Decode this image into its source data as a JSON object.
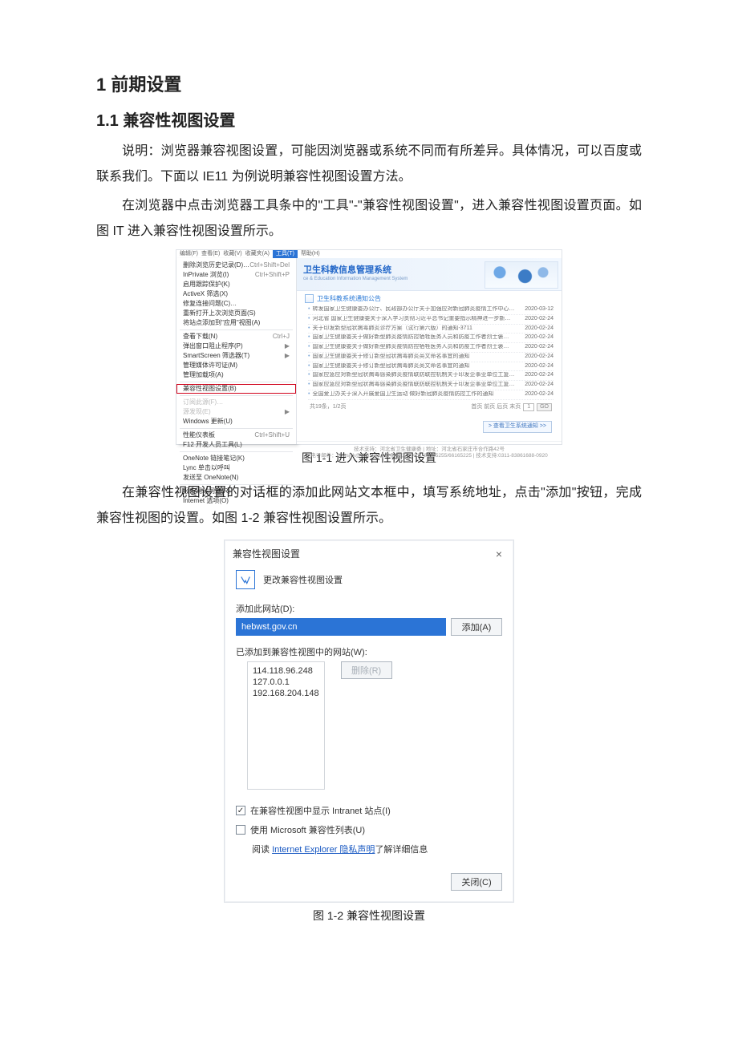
{
  "h1": "1 前期设置",
  "h2": "1.1  兼容性视图设置",
  "p1": "说明：浏览器兼容视图设置，可能因浏览器或系统不同而有所差异。具体情况，可以百度或联系我们。下面以 IE11 为例说明兼容性视图设置方法。",
  "p2": "在浏览器中点击浏览器工具条中的\"工具\"-\"兼容性视图设置\"，进入兼容性视图设置页面。如图 IT 进入兼容性视图设置所示。",
  "p3": "在兼容性视图设置的对话框的添加此网站文本框中，填写系统地址，点击\"添加\"按钮，完成兼容性视图的设置。如图 1-2 兼容性视图设置所示。",
  "fig1_caption": "图 1-1 进入兼容性视图设置",
  "fig2_caption": "图 1-2 兼容性视图设置",
  "fig1": {
    "menubar": [
      "编辑(F)",
      "查看(E)",
      "收藏(V)",
      "收藏夹(A)"
    ],
    "menubar_tools": "工具(T)",
    "menubar_help": "帮助(H)",
    "menu": [
      {
        "label": "删除浏览历史记录(D)…",
        "sc": "Ctrl+Shift+Del"
      },
      {
        "label": "InPrivate 浏览(I)",
        "sc": "Ctrl+Shift+P"
      },
      {
        "label": "启用跟踪保护(K)",
        "sc": ""
      },
      {
        "label": "ActiveX 筛选(X)",
        "sc": ""
      },
      {
        "label": "修复连接问题(C)…",
        "sc": ""
      },
      {
        "label": "重新打开上次浏览页面(S)",
        "sc": ""
      },
      {
        "label": "将站点添加到\"应用\"视图(A)",
        "sc": ""
      },
      {
        "sep": true
      },
      {
        "label": "查看下载(N)",
        "sc": "Ctrl+J"
      },
      {
        "label": "弹出窗口阻止程序(P)",
        "sc": "",
        "arrow": true
      },
      {
        "label": "SmartScreen 筛选器(T)",
        "sc": "",
        "arrow": true
      },
      {
        "label": "管理媒体许可证(M)",
        "sc": ""
      },
      {
        "label": "管理加载项(A)",
        "sc": ""
      },
      {
        "sep": true
      },
      {
        "label": "兼容性视图设置(B)",
        "sc": "",
        "hi": true
      },
      {
        "sep": true
      },
      {
        "label": "订阅此源(F)…",
        "sc": "",
        "disabled": true
      },
      {
        "label": "源发现(E)",
        "sc": "",
        "arrow": true,
        "disabled": true
      },
      {
        "label": "Windows 更新(U)",
        "sc": ""
      },
      {
        "sep": true
      },
      {
        "label": "性能仪表板",
        "sc": "Ctrl+Shift+U"
      },
      {
        "label": "F12 开发人员工具(L)",
        "sc": ""
      },
      {
        "sep": true
      },
      {
        "label": "OneNote 链接笔记(K)",
        "sc": ""
      },
      {
        "label": "Lync 单击以呼叫",
        "sc": ""
      },
      {
        "label": "发送至 OneNote(N)",
        "sc": ""
      },
      {
        "sep": true
      },
      {
        "label": "报告网站问题(R)",
        "sc": ""
      },
      {
        "label": "Internet 选项(O)",
        "sc": ""
      }
    ],
    "banner_title": "卫生科教信息管理系统",
    "banner_sub": "ce & Education Information Management System",
    "section_title": "卫生科教系统通知公告",
    "news": [
      {
        "t": "转发国家卫生健康委办公厅、民政部办公厅关于加强应对新冠肺炎疫情工作中心…",
        "d": "2020-03-12"
      },
      {
        "t": "河北省 国家卫生健康委关于深入学习贯彻习近平总书记重要指示精神进一步新…",
        "d": "2020-02-24"
      },
      {
        "t": "关于印发新型冠状病毒肺炎诊疗方案（试行第六版）的通知-3711",
        "d": "2020-02-24"
      },
      {
        "t": "国家卫生健康委关于做好新型肺炎疫情防控牺牲医务人员和防疫工作者烈士褒…",
        "d": "2020-02-24"
      },
      {
        "t": "国家卫生健康委关于做好新型肺炎疫情防控牺牲医务人员和防疫工作者烈士褒…",
        "d": "2020-02-24"
      },
      {
        "t": "国家卫生健康委关于修订新型冠状病毒肺炎英文命名事宜的通知",
        "d": "2020-02-24"
      },
      {
        "t": "国家卫生健康委关于修订新型冠状病毒肺炎英文命名事宜的通知",
        "d": "2020-02-24"
      },
      {
        "t": "国家应急应对新型冠状病毒感染肺炎疫情联防联控机制关于印发企事业单位工复…",
        "d": "2020-02-24"
      },
      {
        "t": "国家应急应对新型冠状病毒感染肺炎疫情联防联控机制关于印发企事业单位工复…",
        "d": "2020-02-24"
      },
      {
        "t": "全国爱卫办关于深入开展爱国卫生运动 做好新冠肺炎疫情防控工作的通知",
        "d": "2020-02-24"
      }
    ],
    "pager_left": "共19条，1/2页",
    "pager_nav": "首页  前页  后页  末页",
    "pager_go": "GO",
    "pager_page": "1",
    "more_btn": "> 查看卫生系统通知 >>",
    "footer1": "技术支持：河北省卫生健康委 | 地址：河北省石家庄市合作路42号",
    "footer2": "电子邮件：hbwsjyk@126.com | 联系电话：0311-86105255/66165225 | 技术支持:0311-83861688-0920"
  },
  "fig2": {
    "title": "兼容性视图设置",
    "head": "更改兼容性视图设置",
    "add_label": "添加此网站(D):",
    "add_value": "hebwst.gov.cn",
    "add_btn": "添加(A)",
    "list_label": "已添加到兼容性视图中的网站(W):",
    "list": [
      "114.118.96.248",
      "127.0.0.1",
      "192.168.204.148"
    ],
    "remove_btn": "删除(R)",
    "chk_intranet_checked": true,
    "chk_intranet": "在兼容性视图中显示 Intranet 站点(I)",
    "chk_mslist_checked": false,
    "chk_mslist": "使用 Microsoft 兼容性列表(U)",
    "read_prefix": "阅读 ",
    "read_link": "Internet Explorer 隐私声明",
    "read_suffix": "了解详细信息",
    "close_btn": "关闭(C)"
  }
}
